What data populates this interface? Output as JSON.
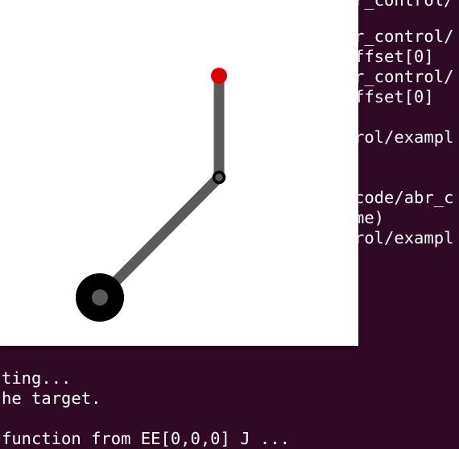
{
  "terminal": {
    "background": "#300a24",
    "foreground": "#ffffff",
    "right_lines": [
      "r_control/",
      "r_control/",
      "ffset[0]",
      "r_control/",
      "ffset[0]",
      "rol/exampl",
      "code/abr_c",
      "me)",
      "rol/exampl"
    ],
    "bottom_lines": [
      "ting...",
      "he target.",
      "function from EE[0,0,0] J ..."
    ]
  },
  "plot": {
    "background": "#ffffff",
    "link_color": "#5a5a5a",
    "base_color": "#000000",
    "joint_color": "#000000",
    "target_color": "#e00000"
  }
}
